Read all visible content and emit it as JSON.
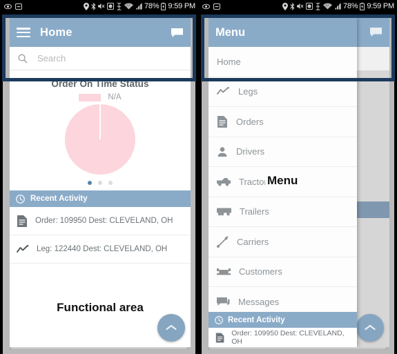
{
  "statusbar": {
    "left_icons": [
      "eye-icon",
      "minus-box-icon"
    ],
    "right_icons": [
      "location-icon",
      "bluetooth-icon",
      "mute-icon",
      "alarm-icon",
      "sync-icon",
      "wifi-icon",
      "signal-icon"
    ],
    "battery": "78%",
    "battery_icon": "battery-icon",
    "time": "9:59 PM"
  },
  "left_panel": {
    "annotation": "Functional area",
    "appbar": {
      "menu_icon": "hamburger-icon",
      "title": "Home",
      "chat_icon": "chat-bubble-icon"
    },
    "search": {
      "icon": "search-icon",
      "placeholder": "Search",
      "value": ""
    },
    "chart_card": {
      "title": "Order On Time Status",
      "legend": [
        {
          "label": "N/A",
          "color": "#fcd5dd"
        }
      ],
      "page_dots": {
        "count": 3,
        "active_index": 0
      }
    },
    "recent_activity": {
      "icon": "clock-icon",
      "title": "Recent Activity",
      "rows": [
        {
          "icon": "document-icon",
          "label": "Order: 109950 Dest: CLEVELAND, OH"
        },
        {
          "icon": "chart-line-icon",
          "label": "Leg: 122440 Dest: CLEVELAND, OH"
        }
      ]
    },
    "fab": {
      "icon": "arrow-up-icon",
      "label": "Scroll to top"
    }
  },
  "right_panel": {
    "annotation": "Menu",
    "drawer": {
      "title": "Menu",
      "chat_icon": "chat-bubble-icon",
      "items": [
        {
          "icon": null,
          "label": "Home"
        },
        {
          "icon": "chart-line-icon",
          "label": "Legs"
        },
        {
          "icon": "document-icon",
          "label": "Orders"
        },
        {
          "icon": "person-icon",
          "label": "Drivers"
        },
        {
          "icon": "tractor-icon",
          "label": "Tractors"
        },
        {
          "icon": "trailer-icon",
          "label": "Trailers"
        },
        {
          "icon": "carrier-icon",
          "label": "Carriers"
        },
        {
          "icon": "customers-icon",
          "label": "Customers"
        },
        {
          "icon": "messages-icon",
          "label": "Messages"
        }
      ],
      "recent_activity": {
        "icon": "clock-icon",
        "title": "Recent Activity",
        "rows": [
          {
            "icon": "document-icon",
            "label": "Order: 109950 Dest: CLEVELAND, OH"
          }
        ]
      }
    },
    "fab": {
      "icon": "arrow-up-icon",
      "label": "Scroll to top"
    }
  },
  "colors": {
    "appbar": "#8aabc8",
    "highlight_border": "#1b3a5c",
    "pie_slice": "#fcd5dd",
    "dot_active": "#5784ab",
    "fab": "#85a5c0",
    "statusbar": "#000000"
  },
  "chart_data": {
    "type": "pie",
    "title": "Order On Time Status",
    "categories": [
      "N/A"
    ],
    "values": [
      100
    ],
    "colors": [
      "#fcd5dd"
    ],
    "legend_position": "top",
    "labels_shown": false,
    "annotations": [
      "single full slice, no on-time data available"
    ]
  }
}
